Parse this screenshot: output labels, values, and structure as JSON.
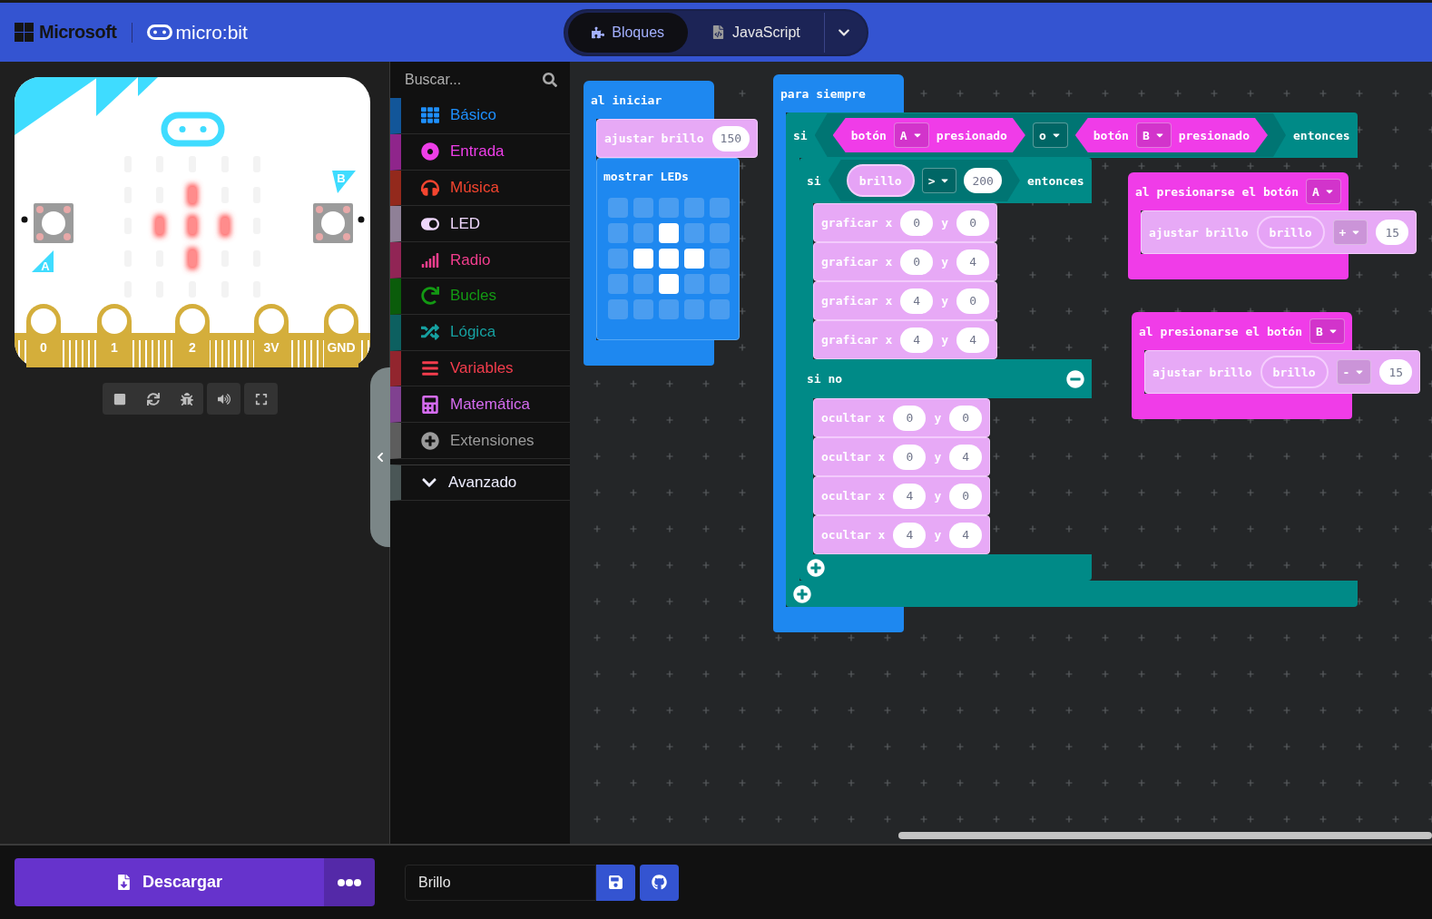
{
  "header": {
    "brand": "Microsoft",
    "product": "micro:bit",
    "editor_tabs": [
      {
        "label": "Bloques",
        "kind": "blocks",
        "selected": true
      },
      {
        "label": "JavaScript",
        "kind": "javascript",
        "selected": false
      }
    ]
  },
  "simulator": {
    "leds": [
      [
        false,
        false,
        false,
        false,
        false
      ],
      [
        false,
        false,
        true,
        false,
        false
      ],
      [
        false,
        true,
        true,
        true,
        false
      ],
      [
        false,
        false,
        true,
        false,
        false
      ],
      [
        false,
        false,
        false,
        false,
        false
      ]
    ],
    "pins": [
      "0",
      "1",
      "2",
      "3V",
      "GND"
    ],
    "buttons": [
      "A",
      "B"
    ]
  },
  "toolbox": {
    "search": {
      "placeholder": "Buscar..."
    },
    "categories": [
      {
        "label": "Básico",
        "kind": "basic",
        "color": "#1e90ff"
      },
      {
        "label": "Entrada",
        "kind": "input",
        "color": "#ee3ee8"
      },
      {
        "label": "Música",
        "kind": "music",
        "color": "#f5452f"
      },
      {
        "label": "LED",
        "kind": "led",
        "color": "#eed6fb"
      },
      {
        "label": "Radio",
        "kind": "radio",
        "color": "#f23e8e"
      },
      {
        "label": "Bucles",
        "kind": "loops",
        "color": "#139a13"
      },
      {
        "label": "Lógica",
        "kind": "logic",
        "color": "#16a0a0"
      },
      {
        "label": "Variables",
        "kind": "variables",
        "color": "#f43d4d"
      },
      {
        "label": "Matemática",
        "kind": "math",
        "color": "#d56cf0"
      },
      {
        "label": "Extensiones",
        "kind": "extensions",
        "color": "#9b9b9b"
      }
    ],
    "advanced": {
      "label": "Avanzado"
    }
  },
  "workspace": {
    "stacks": [
      {
        "kind": "hat",
        "color": "#1e88f0",
        "label": [
          {
            "kind": "text",
            "text": "al iniciar"
          }
        ],
        "body": [
          {
            "kind": "statement",
            "color": "#e7a9f6",
            "parts": [
              {
                "kind": "text",
                "text": "ajustar brillo"
              },
              {
                "kind": "number",
                "text": "150"
              }
            ]
          },
          {
            "kind": "leds",
            "color": "#1e88f0",
            "label": "mostrar LEDs",
            "leds": [
              [
                false,
                false,
                false,
                false,
                false
              ],
              [
                false,
                false,
                true,
                false,
                false
              ],
              [
                false,
                true,
                true,
                true,
                false
              ],
              [
                false,
                false,
                true,
                false,
                false
              ],
              [
                false,
                false,
                false,
                false,
                false
              ]
            ]
          }
        ]
      },
      {
        "kind": "hat",
        "color": "#1e88f0",
        "label": [
          {
            "kind": "text",
            "text": "para siempre"
          }
        ],
        "body": [
          {
            "kind": "if",
            "color": "#008a87",
            "branches": [
              {
                "parts": [
                  {
                    "kind": "text",
                    "text": "si"
                  },
                  {
                    "kind": "hex",
                    "color": "#007573",
                    "parts": [
                      {
                        "kind": "hex",
                        "color": "#f03ce8",
                        "parts": [
                          {
                            "kind": "text",
                            "text": "botón"
                          },
                          {
                            "kind": "dropdown",
                            "text": "A"
                          },
                          {
                            "kind": "text",
                            "text": "presionado"
                          }
                        ]
                      },
                      {
                        "kind": "dropdown",
                        "text": "o"
                      },
                      {
                        "kind": "hex",
                        "color": "#f03ce8",
                        "parts": [
                          {
                            "kind": "text",
                            "text": "botón"
                          },
                          {
                            "kind": "dropdown",
                            "text": "B"
                          },
                          {
                            "kind": "text",
                            "text": "presionado"
                          }
                        ]
                      }
                    ]
                  },
                  {
                    "kind": "text",
                    "text": "entonces"
                  }
                ],
                "body": [
                  {
                    "kind": "if",
                    "color": "#008a87",
                    "branches": [
                      {
                        "parts": [
                          {
                            "kind": "text",
                            "text": "si"
                          },
                          {
                            "kind": "hex",
                            "color": "#007573",
                            "parts": [
                              {
                                "kind": "variable",
                                "text": "brillo"
                              },
                              {
                                "kind": "dropdown",
                                "text": ">"
                              },
                              {
                                "kind": "number",
                                "text": "200"
                              }
                            ]
                          },
                          {
                            "kind": "text",
                            "text": "entonces"
                          }
                        ],
                        "body": [
                          {
                            "kind": "statement",
                            "color": "#e7a9f6",
                            "parts": [
                              {
                                "kind": "text",
                                "text": "graficar x"
                              },
                              {
                                "kind": "number",
                                "text": "0"
                              },
                              {
                                "kind": "text",
                                "text": "y"
                              },
                              {
                                "kind": "number",
                                "text": "0"
                              }
                            ]
                          },
                          {
                            "kind": "statement",
                            "color": "#e7a9f6",
                            "parts": [
                              {
                                "kind": "text",
                                "text": "graficar x"
                              },
                              {
                                "kind": "number",
                                "text": "0"
                              },
                              {
                                "kind": "text",
                                "text": "y"
                              },
                              {
                                "kind": "number",
                                "text": "4"
                              }
                            ]
                          },
                          {
                            "kind": "statement",
                            "color": "#e7a9f6",
                            "parts": [
                              {
                                "kind": "text",
                                "text": "graficar x"
                              },
                              {
                                "kind": "number",
                                "text": "4"
                              },
                              {
                                "kind": "text",
                                "text": "y"
                              },
                              {
                                "kind": "number",
                                "text": "0"
                              }
                            ]
                          },
                          {
                            "kind": "statement",
                            "color": "#e7a9f6",
                            "parts": [
                              {
                                "kind": "text",
                                "text": "graficar x"
                              },
                              {
                                "kind": "number",
                                "text": "4"
                              },
                              {
                                "kind": "text",
                                "text": "y"
                              },
                              {
                                "kind": "number",
                                "text": "4"
                              }
                            ]
                          }
                        ]
                      }
                    ],
                    "else": {
                      "label": "si no",
                      "body": [
                        {
                          "kind": "statement",
                          "color": "#e7a9f6",
                          "parts": [
                            {
                              "kind": "text",
                              "text": "ocultar x"
                            },
                            {
                              "kind": "number",
                              "text": "0"
                            },
                            {
                              "kind": "text",
                              "text": "y"
                            },
                            {
                              "kind": "number",
                              "text": "0"
                            }
                          ]
                        },
                        {
                          "kind": "statement",
                          "color": "#e7a9f6",
                          "parts": [
                            {
                              "kind": "text",
                              "text": "ocultar x"
                            },
                            {
                              "kind": "number",
                              "text": "0"
                            },
                            {
                              "kind": "text",
                              "text": "y"
                            },
                            {
                              "kind": "number",
                              "text": "4"
                            }
                          ]
                        },
                        {
                          "kind": "statement",
                          "color": "#e7a9f6",
                          "parts": [
                            {
                              "kind": "text",
                              "text": "ocultar x"
                            },
                            {
                              "kind": "number",
                              "text": "4"
                            },
                            {
                              "kind": "text",
                              "text": "y"
                            },
                            {
                              "kind": "number",
                              "text": "0"
                            }
                          ]
                        },
                        {
                          "kind": "statement",
                          "color": "#e7a9f6",
                          "parts": [
                            {
                              "kind": "text",
                              "text": "ocultar x"
                            },
                            {
                              "kind": "number",
                              "text": "4"
                            },
                            {
                              "kind": "text",
                              "text": "y"
                            },
                            {
                              "kind": "number",
                              "text": "4"
                            }
                          ]
                        }
                      ]
                    }
                  }
                ]
              }
            ]
          }
        ]
      },
      {
        "kind": "hat",
        "color": "#f03ce8",
        "label": [
          {
            "kind": "text",
            "text": "al presionarse el botón"
          },
          {
            "kind": "dropdown",
            "text": "A"
          }
        ],
        "body": [
          {
            "kind": "statement",
            "color": "#e7a9f6",
            "parts": [
              {
                "kind": "text",
                "text": "ajustar brillo"
              },
              {
                "kind": "variable",
                "text": "brillo"
              },
              {
                "kind": "dropdown",
                "text": "+"
              },
              {
                "kind": "number",
                "text": "15"
              }
            ]
          }
        ]
      },
      {
        "kind": "hat",
        "color": "#f03ce8",
        "label": [
          {
            "kind": "text",
            "text": "al presionarse el botón"
          },
          {
            "kind": "dropdown",
            "text": "B"
          }
        ],
        "body": [
          {
            "kind": "statement",
            "color": "#e7a9f6",
            "parts": [
              {
                "kind": "text",
                "text": "ajustar brillo"
              },
              {
                "kind": "variable",
                "text": "brillo"
              },
              {
                "kind": "dropdown",
                "text": "-"
              },
              {
                "kind": "number",
                "text": "15"
              }
            ]
          }
        ]
      }
    ]
  },
  "footer": {
    "download_label": "Descargar",
    "project_name": "Brillo"
  }
}
